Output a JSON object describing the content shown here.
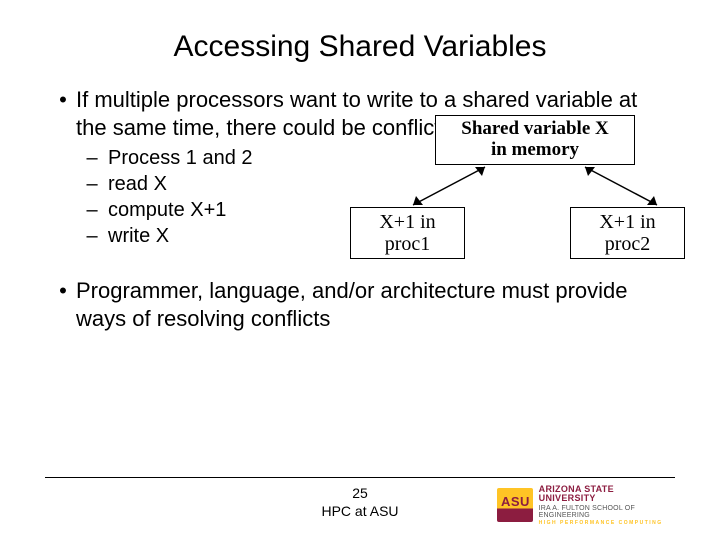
{
  "title": "Accessing Shared Variables",
  "bullet1": "If multiple processors want to write to a shared variable at the same time, there could be conflicts :",
  "sub": {
    "s1": "Process 1 and 2",
    "s2": "read X",
    "s3": "compute X+1",
    "s4": "write X"
  },
  "boxTop": {
    "l1": "Shared variable X",
    "l2": "in memory"
  },
  "boxBL": {
    "l1": "X+1 in",
    "l2": "proc1"
  },
  "boxBR": {
    "l1": "X+1 in",
    "l2": "proc2"
  },
  "bullet2": "Programmer, language, and/or architecture must provide ways of resolving conflicts",
  "footer": {
    "page": "25",
    "label": "HPC at ASU"
  },
  "logo": {
    "l1": "ARIZONA STATE",
    "l2": "UNIVERSITY",
    "l3": "IRA A. FULTON SCHOOL OF ENGINEERING",
    "l4": "HIGH PERFORMANCE COMPUTING"
  }
}
